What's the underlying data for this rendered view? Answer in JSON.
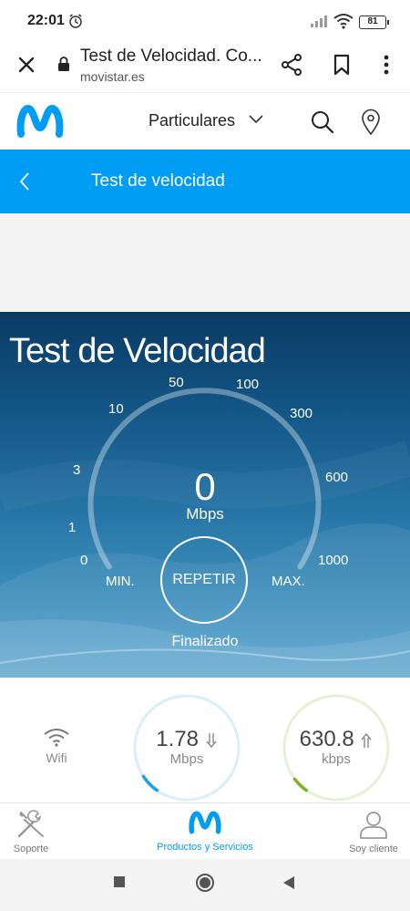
{
  "status_bar": {
    "time": "22:01",
    "battery": "81"
  },
  "browser": {
    "title": "Test de Velocidad. Co...",
    "url": "movistar.es"
  },
  "site_header": {
    "segment": "Particulares"
  },
  "page_bar": {
    "title": "Test de velocidad"
  },
  "speedtest": {
    "title": "Test de Velocidad",
    "value": "0",
    "unit": "Mbps",
    "ticks": [
      "0",
      "1",
      "3",
      "10",
      "50",
      "100",
      "300",
      "600",
      "1000"
    ],
    "min_label": "MIN.",
    "max_label": "MAX.",
    "repeat_label": "REPETIR",
    "status": "Finalizado"
  },
  "results": {
    "connection": "Wifi",
    "download": {
      "value": "1.78",
      "unit": "Mbps",
      "fill": 0.06
    },
    "upload": {
      "value": "630.8",
      "unit": "kbps",
      "fill": 0.05
    }
  },
  "bottom_nav": {
    "items": [
      {
        "label": "Soporte"
      },
      {
        "label": "Productos y Servicios"
      },
      {
        "label": "Soy cliente"
      }
    ]
  },
  "colors": {
    "brand_blue": "#019DF4",
    "download_arc": "#19a2e8",
    "upload_arc": "#7ab51d"
  }
}
